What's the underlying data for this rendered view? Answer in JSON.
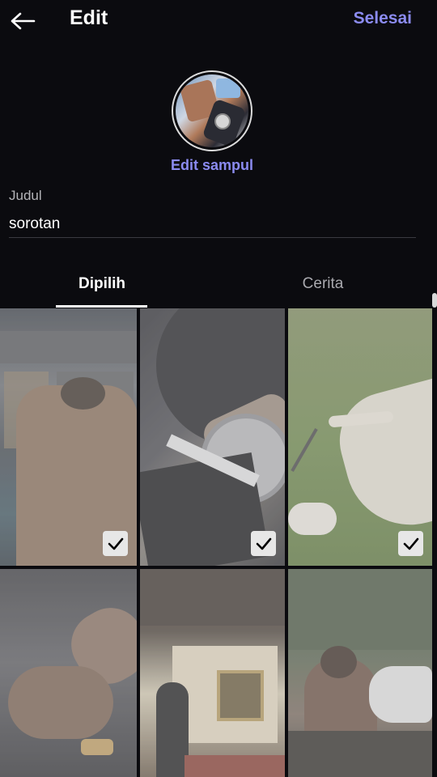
{
  "header": {
    "title": "Edit",
    "done_label": "Selesai"
  },
  "cover": {
    "edit_label": "Edit sampul"
  },
  "field": {
    "label": "Judul",
    "value": "sorotan"
  },
  "tabs": [
    {
      "label": "Dipilih",
      "selected": true
    },
    {
      "label": "Cerita",
      "selected": false
    }
  ],
  "grid": {
    "tiles": [
      {
        "name": "photo-building-pool",
        "checked": true
      },
      {
        "name": "photo-wristwatch",
        "checked": true
      },
      {
        "name": "photo-golf",
        "checked": true
      },
      {
        "name": "photo-hands",
        "checked": false
      },
      {
        "name": "photo-ballroom",
        "checked": false
      },
      {
        "name": "photo-horse",
        "checked": false
      }
    ]
  },
  "colors": {
    "background": "#0b0b0f",
    "accent": "#8b8bf0",
    "text": "#ffffff",
    "muted": "#a9a9ae"
  },
  "icons": {
    "back": "arrow-left-icon",
    "check": "checkmark-icon"
  }
}
